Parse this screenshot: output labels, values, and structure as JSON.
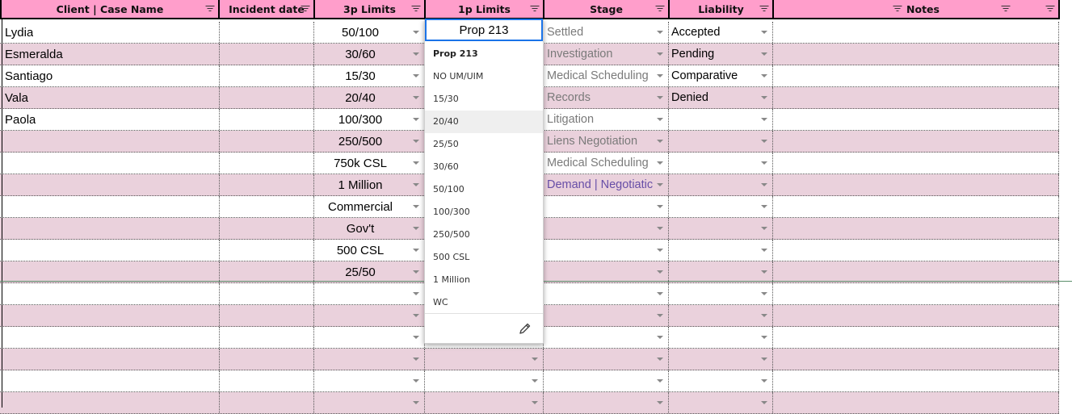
{
  "headers": {
    "client": "Client | Case Name",
    "incident": "Incident date",
    "p3": "3p Limits",
    "p1": "1p Limits",
    "stage": "Stage",
    "liability": "Liability",
    "notes": "Notes"
  },
  "rows": [
    {
      "client": "Lydia",
      "p3": "50/100",
      "stage": "Settled",
      "liability": "Accepted"
    },
    {
      "client": "Esmeralda",
      "p3": "30/60",
      "stage": "Investigation",
      "liability": "Pending"
    },
    {
      "client": "Santiago",
      "p3": "15/30",
      "stage": "Medical Scheduling",
      "liability": "Comparative"
    },
    {
      "client": "Vala",
      "p3": "20/40",
      "stage": "Records",
      "liability": "Denied"
    },
    {
      "client": "Paola",
      "p3": "100/300",
      "stage": "Litigation",
      "liability": ""
    },
    {
      "client": "",
      "p3": "250/500",
      "stage": "Liens Negotiation",
      "liability": ""
    },
    {
      "client": "",
      "p3": "750k CSL",
      "stage": "Medical Scheduling",
      "liability": ""
    },
    {
      "client": "",
      "p3": "1 Million",
      "stage": "Demand | Negotiatic",
      "liability": ""
    },
    {
      "client": "",
      "p3": "Commercial",
      "stage": "",
      "liability": ""
    },
    {
      "client": "",
      "p3": "Gov't",
      "stage": "",
      "liability": ""
    },
    {
      "client": "",
      "p3": "500 CSL",
      "stage": "",
      "liability": ""
    },
    {
      "client": "",
      "p3": "25/50",
      "stage": "",
      "liability": ""
    },
    {
      "client": "",
      "p3": "",
      "stage": "",
      "liability": ""
    },
    {
      "client": "",
      "p3": "",
      "stage": "",
      "liability": ""
    },
    {
      "client": "",
      "p3": "",
      "stage": "",
      "liability": ""
    },
    {
      "client": "",
      "p3": "",
      "stage": "",
      "liability": ""
    },
    {
      "client": "",
      "p3": "",
      "stage": "",
      "liability": ""
    },
    {
      "client": "",
      "p3": "",
      "stage": "",
      "liability": ""
    }
  ],
  "dropdown": {
    "current_value": "Prop 213",
    "options": [
      "Prop 213",
      "NO UM/UIM",
      "15/30",
      "20/40",
      "25/50",
      "30/60",
      "50/100",
      "100/300",
      "250/500",
      "500 CSL",
      "1 Million",
      "WC"
    ],
    "highlighted": "20/40",
    "edit_icon": "pencil-icon"
  },
  "colors": {
    "header_bg": "#ff9ecb",
    "stripe_bg": "#ead1dc",
    "selection_border": "#1a73e8",
    "stage_text": "#7a7a7a",
    "stage_purple": "#674ea7"
  }
}
